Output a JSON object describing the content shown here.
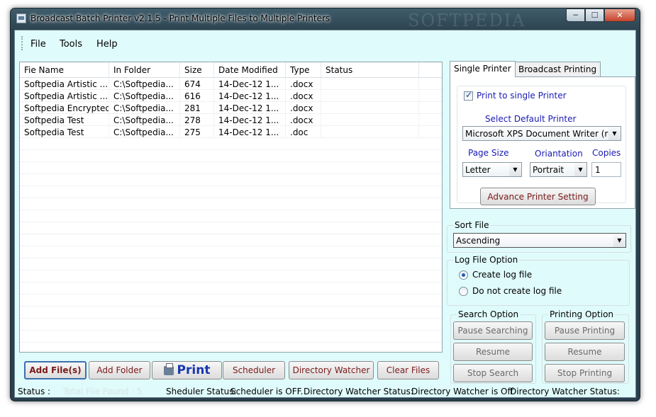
{
  "window": {
    "title": "Broadcast Batch Printer v2.1.5 - Print Multiple Files to Multiple Printers",
    "watermark": "SOFTPEDIA",
    "minimize": "─",
    "maximize": "☐",
    "close": "✕"
  },
  "menu": {
    "file": "File",
    "tools": "Tools",
    "help": "Help"
  },
  "file_list": {
    "headers": [
      "Fie Name",
      "In Folder",
      "Size",
      "Date Modified",
      "Type",
      "Status"
    ],
    "rows": [
      [
        "Softpedia Artistic ...",
        "C:\\Softpedia...",
        "674",
        "14-Dec-12 1...",
        ".docx",
        ""
      ],
      [
        "Softpedia Artistic ...",
        "C:\\Softpedia...",
        "616",
        "14-Dec-12 1...",
        ".docx",
        ""
      ],
      [
        "Softpedia Encrypted",
        "C:\\Softpedia...",
        "281",
        "14-Dec-12 1...",
        ".docx",
        ""
      ],
      [
        "Softpedia Test",
        "C:\\Softpedia...",
        "278",
        "14-Dec-12 1...",
        ".docx",
        ""
      ],
      [
        "Softpedia Test",
        "C:\\Softpedia...",
        "275",
        "14-Dec-12 1...",
        ".doc",
        ""
      ]
    ]
  },
  "buttons": {
    "add_files": "Add File(s)",
    "add_folder": "Add Folder",
    "print": "Print",
    "scheduler": "Scheduler",
    "directory_watcher": "Directory Watcher",
    "clear_files": "Clear Files"
  },
  "status": {
    "label": "Status :",
    "total_files": "Total File Found : 5",
    "scheduler_label": "Sheduler Status:",
    "scheduler_value": "Scheduler is OFF.",
    "dir_watcher_label": "Directory Watcher Status:",
    "dir_watcher_value": "Directory Watcher is Off",
    "dir_watcher_label2": "Directory Watcher Status:"
  },
  "tabs": {
    "single": "Single Printer",
    "broadcast": "Broadcast Printing"
  },
  "single_printer": {
    "print_to_single": "Print to single Printer",
    "select_default_label": "Select Default Printer",
    "default_printer": "Microsoft XPS Document Writer (re",
    "page_size_label": "Page Size",
    "orientation_label": "Oriantation",
    "copies_label": "Copies",
    "page_size": "Letter",
    "orientation": "Portrait",
    "copies": "1",
    "advance_button": "Advance Printer Setting"
  },
  "sort": {
    "label": "Sort File",
    "value": "Ascending"
  },
  "log": {
    "label": "Log File Option",
    "create": "Create log file",
    "no_create": "Do not create log file"
  },
  "search_option": {
    "label": "Search Option",
    "pause": "Pause Searching",
    "resume": "Resume",
    "stop": "Stop Search"
  },
  "printing_option": {
    "label": "Printing Option",
    "pause": "Pause Printing",
    "resume": "Resume",
    "stop": "Stop Printing"
  },
  "colors": {
    "client_bg": "#e0fbfb",
    "button_text": "#7a1a1a",
    "label_blue": "#1a1ab4",
    "print_blue": "#1737b0"
  }
}
